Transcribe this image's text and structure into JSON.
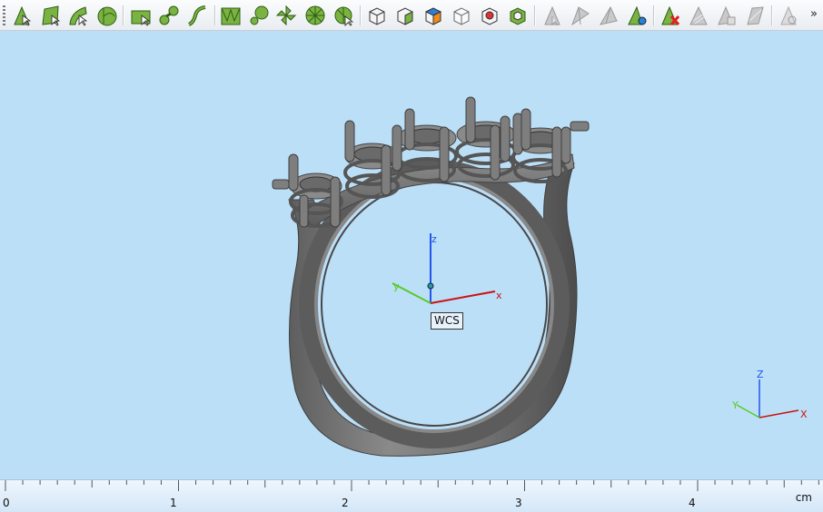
{
  "toolbar": {
    "groups": [
      {
        "icons": [
          "point-select-icon",
          "face-select-icon",
          "edge-select-icon",
          "curve-select-icon"
        ]
      },
      {
        "icons": [
          "plane-surface-icon",
          "blend-surface-icon",
          "sweep-curve-icon"
        ]
      },
      {
        "icons": [
          "mesh-surface-icon",
          "loft-surface-icon",
          "pattern-icon",
          "revolve-icon",
          "network-surface-icon"
        ]
      },
      {
        "icons": [
          "solid-box-icon",
          "solid-add-icon",
          "solid-highlight-icon",
          "solid-outline-icon",
          "solid-section-icon",
          "solid-shell-icon"
        ]
      },
      {
        "icons": [
          "arrow-disabled-icon",
          "split-disabled-icon",
          "trim-disabled-icon",
          "extend-icon"
        ]
      },
      {
        "icons": [
          "delete-icon",
          "shade-disabled-icon",
          "copy-disabled-icon",
          "plane-disabled-icon"
        ]
      },
      {
        "icons": [
          "view-disabled-icon"
        ]
      }
    ],
    "more": "»"
  },
  "viewport": {
    "wcs_label": "WCS",
    "axes": {
      "x": "x",
      "y": "y",
      "z": "z"
    },
    "mini_axes": {
      "x": "X",
      "y": "Y",
      "z": "Z"
    },
    "colors": {
      "background": "#bcdff8",
      "model": "#7d7d7d",
      "x_axis": "#cc1111",
      "y_axis": "#55cc22",
      "z_axis": "#2255ee"
    }
  },
  "ruler": {
    "labels": [
      "0",
      "1",
      "2",
      "3",
      "4"
    ],
    "unit": "cm"
  }
}
